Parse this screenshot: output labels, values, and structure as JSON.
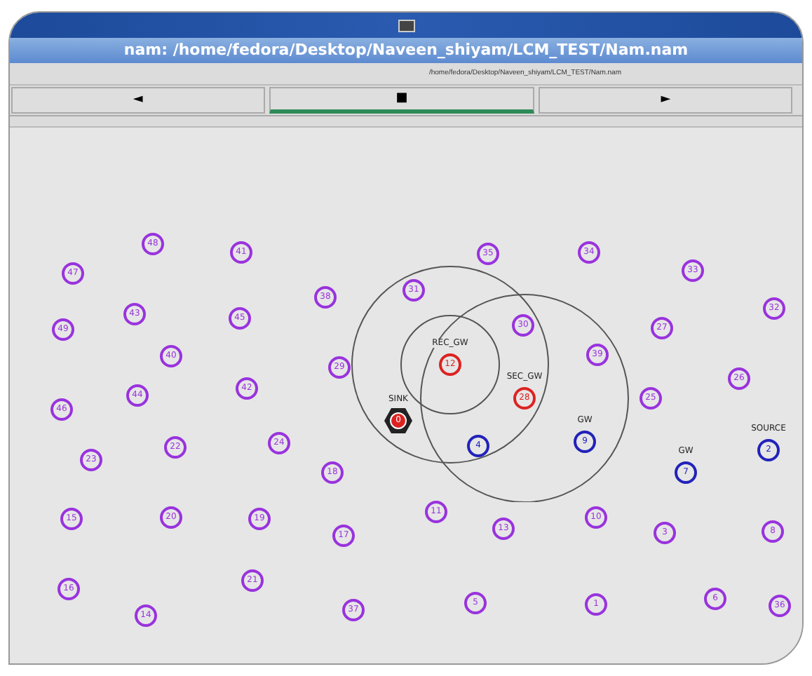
{
  "window": {
    "title": "nam: /home/fedora/Desktop/Naveen_shiyam/LCM_TEST/Nam.nam"
  },
  "file_path": "/home/fedora/Desktop/Naveen_shiyam/LCM_TEST/Nam.nam",
  "controls": [
    {
      "label": "◄",
      "selected": false
    },
    {
      "label": "■",
      "selected": true
    },
    {
      "label": "►",
      "selected": false
    }
  ],
  "nodes": [
    {
      "id": "48",
      "color": "#9933dd",
      "kind": "circle"
    },
    {
      "id": "41",
      "color": "#9933dd",
      "kind": "circle"
    },
    {
      "id": "35",
      "color": "#9933dd",
      "kind": "circle"
    },
    {
      "id": "34",
      "color": "#9933dd",
      "kind": "circle"
    },
    {
      "id": "47",
      "color": "#9933dd",
      "kind": "circle"
    },
    {
      "id": "33",
      "color": "#9933dd",
      "kind": "circle"
    },
    {
      "id": "38",
      "color": "#9933dd",
      "kind": "circle"
    },
    {
      "id": "31",
      "color": "#9933dd",
      "kind": "circle"
    },
    {
      "id": "43",
      "color": "#9933dd",
      "kind": "circle"
    },
    {
      "id": "45",
      "color": "#9933dd",
      "kind": "circle"
    },
    {
      "id": "32",
      "color": "#9933dd",
      "kind": "circle"
    },
    {
      "id": "49",
      "color": "#9933dd",
      "kind": "circle"
    },
    {
      "id": "30",
      "color": "#9933dd",
      "kind": "circle"
    },
    {
      "id": "27",
      "color": "#9933dd",
      "kind": "circle"
    },
    {
      "id": "40",
      "color": "#9933dd",
      "kind": "circle"
    },
    {
      "id": "29",
      "color": "#9933dd",
      "kind": "circle"
    },
    {
      "id": "12",
      "color": "#dd2222",
      "kind": "circle",
      "label": "REC_GW"
    },
    {
      "id": "39",
      "color": "#9933dd",
      "kind": "circle"
    },
    {
      "id": "42",
      "color": "#9933dd",
      "kind": "circle"
    },
    {
      "id": "26",
      "color": "#9933dd",
      "kind": "circle"
    },
    {
      "id": "44",
      "color": "#9933dd",
      "kind": "circle"
    },
    {
      "id": "28",
      "color": "#dd2222",
      "kind": "circle",
      "label": "SEC_GW"
    },
    {
      "id": "25",
      "color": "#9933dd",
      "kind": "circle"
    },
    {
      "id": "46",
      "color": "#9933dd",
      "kind": "circle"
    },
    {
      "id": "0",
      "color": "#dd2222",
      "kind": "hexagon",
      "label": "SINK"
    },
    {
      "id": "22",
      "color": "#9933dd",
      "kind": "circle"
    },
    {
      "id": "24",
      "color": "#9933dd",
      "kind": "circle"
    },
    {
      "id": "4",
      "color": "#2222bb",
      "kind": "circle"
    },
    {
      "id": "9",
      "color": "#2222bb",
      "kind": "circle",
      "label": "GW"
    },
    {
      "id": "2",
      "color": "#2222bb",
      "kind": "circle",
      "label": "SOURCE"
    },
    {
      "id": "23",
      "color": "#9933dd",
      "kind": "circle"
    },
    {
      "id": "18",
      "color": "#9933dd",
      "kind": "circle"
    },
    {
      "id": "7",
      "color": "#2222bb",
      "kind": "circle",
      "label": "GW"
    },
    {
      "id": "15",
      "color": "#9933dd",
      "kind": "circle"
    },
    {
      "id": "20",
      "color": "#9933dd",
      "kind": "circle"
    },
    {
      "id": "19",
      "color": "#9933dd",
      "kind": "circle"
    },
    {
      "id": "11",
      "color": "#9933dd",
      "kind": "circle"
    },
    {
      "id": "10",
      "color": "#9933dd",
      "kind": "circle"
    },
    {
      "id": "17",
      "color": "#9933dd",
      "kind": "circle"
    },
    {
      "id": "13",
      "color": "#9933dd",
      "kind": "circle"
    },
    {
      "id": "3",
      "color": "#9933dd",
      "kind": "circle"
    },
    {
      "id": "8",
      "color": "#9933dd",
      "kind": "circle"
    },
    {
      "id": "16",
      "color": "#9933dd",
      "kind": "circle"
    },
    {
      "id": "21",
      "color": "#9933dd",
      "kind": "circle"
    },
    {
      "id": "37",
      "color": "#9933dd",
      "kind": "circle"
    },
    {
      "id": "5",
      "color": "#9933dd",
      "kind": "circle"
    },
    {
      "id": "1",
      "color": "#9933dd",
      "kind": "circle"
    },
    {
      "id": "6",
      "color": "#9933dd",
      "kind": "circle"
    },
    {
      "id": "36",
      "color": "#9933dd",
      "kind": "circle"
    },
    {
      "id": "14",
      "color": "#9933dd",
      "kind": "circle"
    }
  ]
}
